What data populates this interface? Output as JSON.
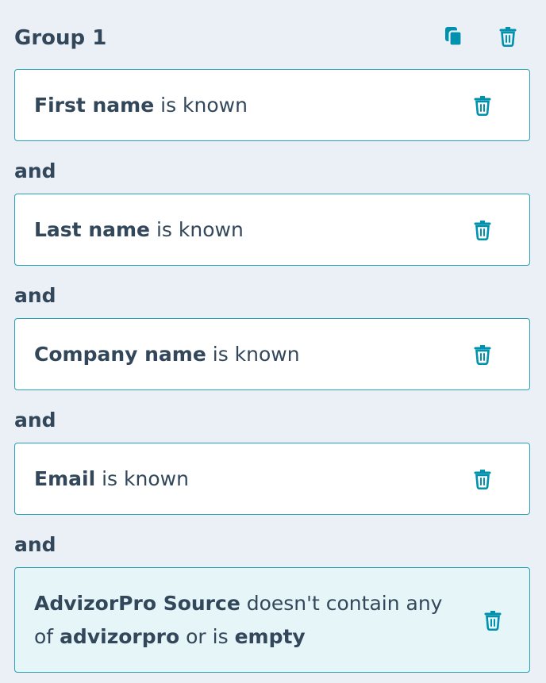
{
  "group": {
    "title": "Group 1",
    "clone_icon": "clone-icon",
    "delete_icon": "trash-icon"
  },
  "colors": {
    "background": "#eaf0f6",
    "accent": "#0091ae",
    "border": "#26a1b5",
    "text": "#33475b",
    "highlight_background": "#e5f5f8"
  },
  "connector": "and",
  "filters": [
    {
      "property": "First name",
      "operator": "is known",
      "delete_icon": "trash-icon"
    },
    {
      "property": "Last name",
      "operator": "is known",
      "delete_icon": "trash-icon"
    },
    {
      "property": "Company name",
      "operator": "is known",
      "delete_icon": "trash-icon"
    },
    {
      "property": "Email",
      "operator": "is known",
      "delete_icon": "trash-icon"
    },
    {
      "property": "AdvizorPro Source",
      "operator": "doesn't contain any of",
      "value": "advizorpro",
      "or_label": "or is",
      "empty_label": "empty",
      "delete_icon": "trash-icon"
    }
  ]
}
